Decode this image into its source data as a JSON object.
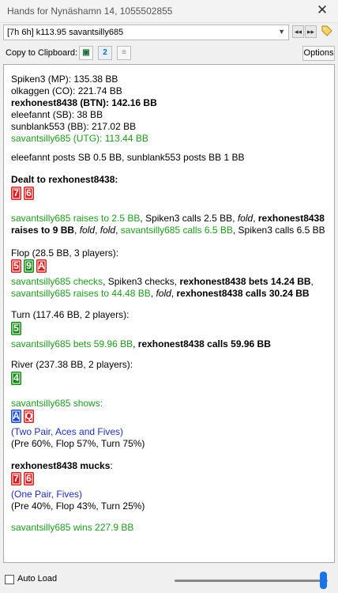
{
  "window": {
    "title": "Hands for Nynäshamn 14, 1055502855",
    "close_label": "✕"
  },
  "header": {
    "hand_select_value": "[7h 6h] k113.95 savantsilly685",
    "prev_label": "◂◂",
    "next_label": "▸▸"
  },
  "toolbar": {
    "copy_label": "Copy to Clipboard:",
    "options_label": "Options"
  },
  "colors": {
    "green": "#1e9a1e",
    "blue": "#1f2db8",
    "red_card": "#d42020",
    "green_card": "#128a12",
    "blue_card": "#1a49c8"
  },
  "log": {
    "seats": [
      "Spiken3 (MP): 135.38 BB",
      "olkaggen (CO): 221.74 BB",
      "rexhonest8438 (BTN): 142.16 BB",
      "eleefannt (SB): 38 BB",
      "sunblank553 (BB): 217.02 BB",
      "savantsilly685 (UTG): 113.44 BB"
    ],
    "blinds": "eleefannt posts SB 0.5 BB, sunblank553 posts BB 1 BB",
    "dealt_label": "Dealt to rexhonest8438:",
    "hero_cards": [
      "7",
      "6"
    ],
    "preflop": {
      "p1": "savantsilly685 raises to 2.5 BB",
      "p2": ", Spiken3 calls 2.5 BB, ",
      "p3": "fold",
      "p4": ", ",
      "p5": "rexhonest8438",
      "p6": "raises to 9 BB",
      "p7": ", ",
      "p8": "fold",
      "p9": ", ",
      "p10": "fold",
      "p11": ", ",
      "p12": "savantsilly685 calls 6.5 BB",
      "p13": ", Spiken3 calls 6.5 BB"
    },
    "flop_header": "Flop (28.5 BB, 3 players):",
    "flop_cards": [
      "5",
      "9",
      "A"
    ],
    "flop": {
      "p1": "savantsilly685 checks",
      "p2": ", Spiken3 checks, ",
      "p3": "rexhonest8438 bets 14.24 BB",
      "p4": ",",
      "p5": "savantsilly685 raises to 44.48 BB",
      "p6": ", ",
      "p7": "fold",
      "p8": ", ",
      "p9": "rexhonest8438 calls 30.24 BB"
    },
    "turn_header": "Turn (117.46 BB, 2 players):",
    "turn_card": "5",
    "turn": {
      "p1": "savantsilly685 bets 59.96 BB",
      "p2": ", ",
      "p3": "rexhonest8438 calls 59.96 BB"
    },
    "river_header": "River (237.38 BB, 2 players):",
    "river_card": "4",
    "villain_shows": "savantsilly685 shows:",
    "villain_cards": [
      "A",
      "Q"
    ],
    "villain_hand": "(Two Pair, Aces and Fives)",
    "villain_equity": "(Pre 60%, Flop 57%, Turn 75%)",
    "hero_mucks": "rexhonest8438 mucks",
    "hero_mucks_suffix": ":",
    "hero_muck_cards": [
      "7",
      "6"
    ],
    "hero_hand": "(One Pair, Fives)",
    "hero_equity": "(Pre 40%, Flop 43%, Turn 25%)",
    "winner": "savantsilly685 wins 227.9 BB"
  },
  "footer": {
    "auto_load_label": "Auto Load"
  }
}
